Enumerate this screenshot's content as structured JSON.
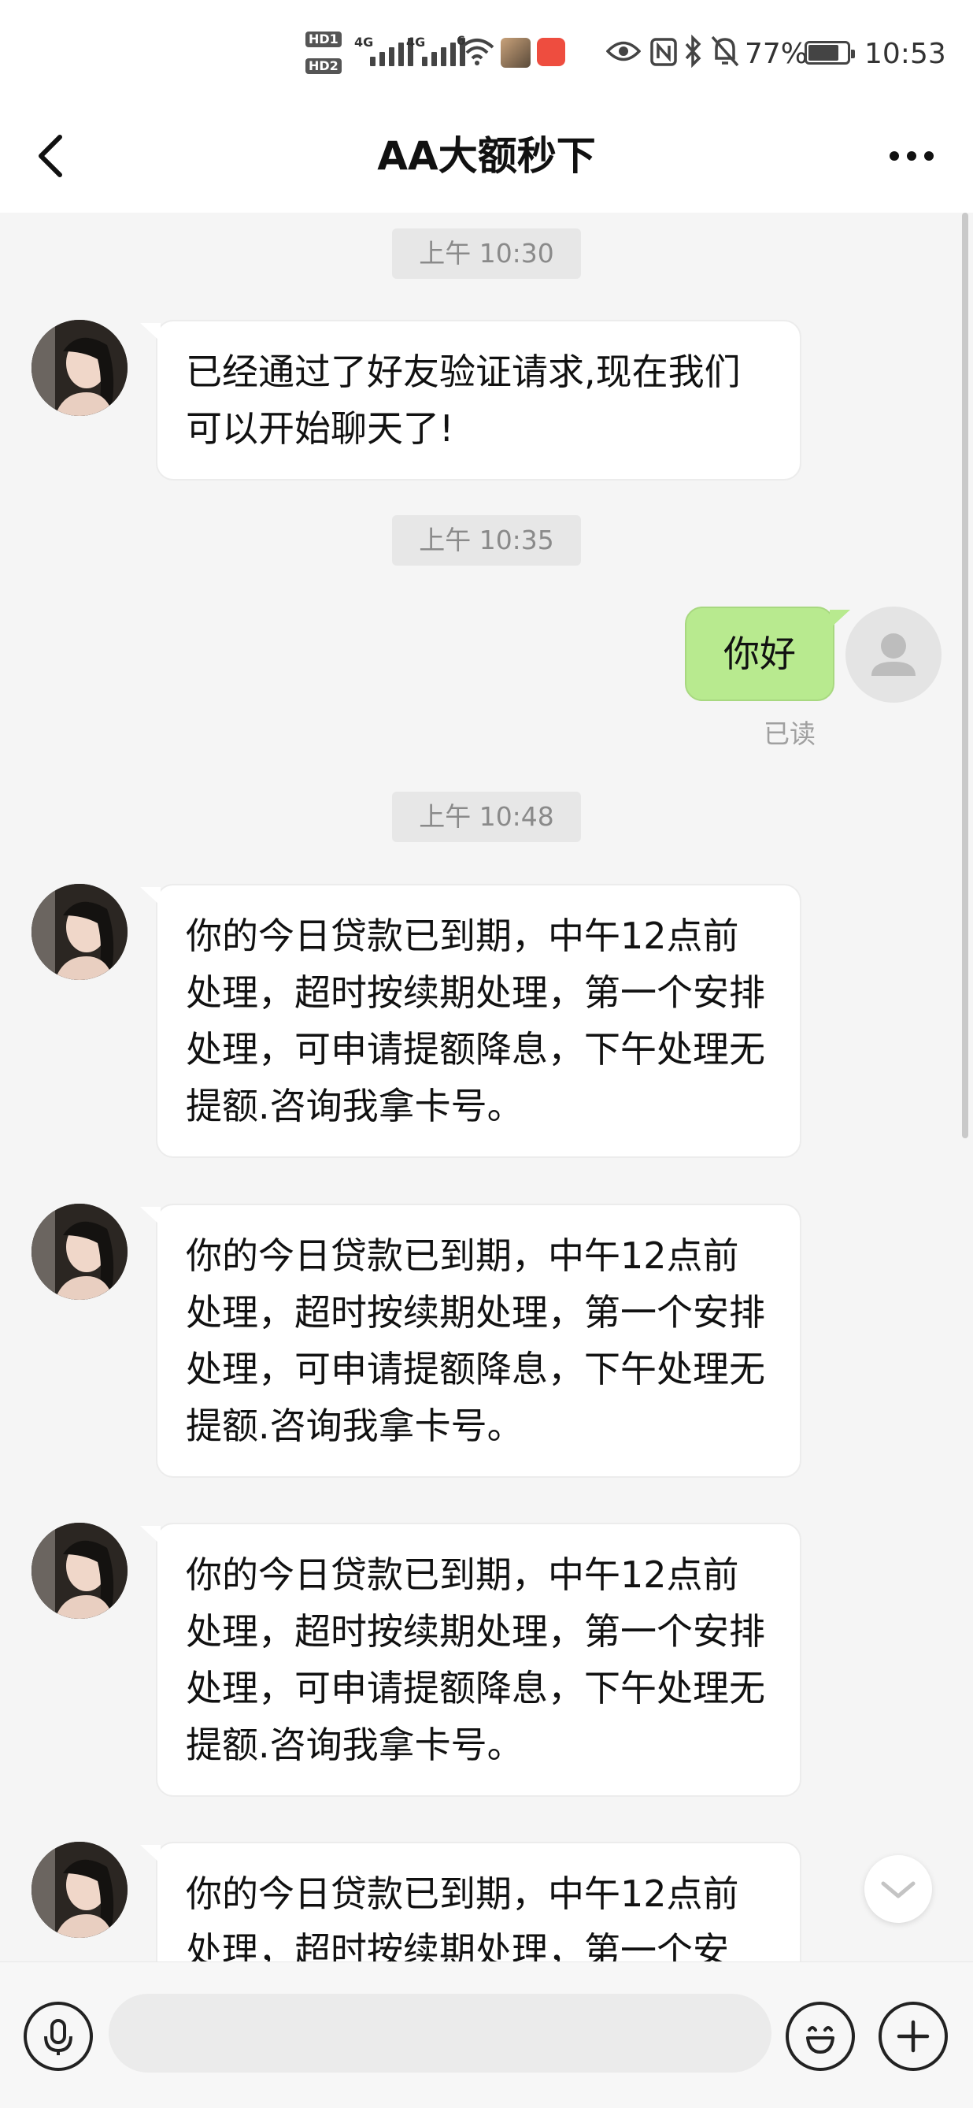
{
  "status_bar": {
    "network1": "4G",
    "network2": "4G",
    "wifi_badge": "6",
    "battery_percent": "77%",
    "time": "10:53"
  },
  "header": {
    "title": "AA大额秒下"
  },
  "messages": {
    "t1": "上午 10:30",
    "m1": "已经通过了好友验证请求,现在我们可以开始聊天了!",
    "t2": "上午 10:35",
    "me1": "你好",
    "me1_status": "已读",
    "t3": "上午 10:48",
    "m2": "你的今日贷款已到期，中午12点前处理，超时按续期处理，第一个安排处理，可申请提额降息，下午处理无提额.咨询我拿卡号。",
    "m3": "你的今日贷款已到期，中午12点前处理，超时按续期处理，第一个安排处理，可申请提额降息，下午处理无提额.咨询我拿卡号。",
    "m4": "你的今日贷款已到期，中午12点前处理，超时按续期处理，第一个安排处理，可申请提额降息，下午处理无提额.咨询我拿卡号。",
    "m5": "你的今日贷款已到期，中午12点前处理，超时按续期处理，第一个安"
  },
  "input": {
    "value": "",
    "placeholder": ""
  },
  "colors": {
    "my_bubble": "#b8ea8f",
    "chat_bg": "#f5f5f5"
  }
}
